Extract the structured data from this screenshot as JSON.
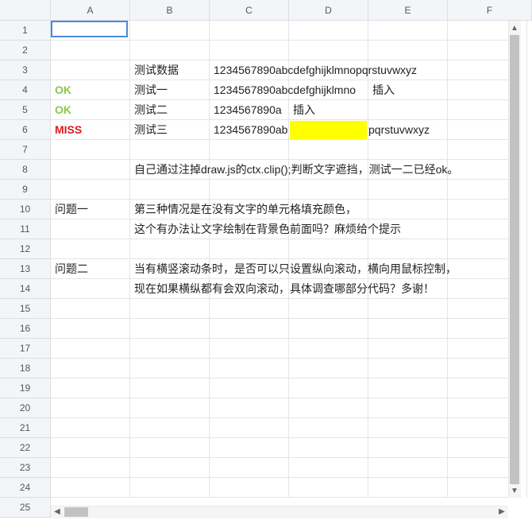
{
  "columns": [
    "A",
    "B",
    "C",
    "D",
    "E",
    "F"
  ],
  "rows": [
    "1",
    "2",
    "3",
    "4",
    "5",
    "6",
    "7",
    "8",
    "9",
    "10",
    "11",
    "12",
    "13",
    "14",
    "15",
    "16",
    "17",
    "18",
    "19",
    "20",
    "21",
    "22",
    "23",
    "24",
    "25"
  ],
  "cells": {
    "b3": "测试数据",
    "c3": "1234567890abcdefghijklmnopqrstuvwxyz",
    "a4": "OK",
    "b4": "测试一",
    "c4": "1234567890abcdefghijklmno",
    "d4": "插入",
    "a5": "OK",
    "b5": "测试二",
    "c5": "1234567890a",
    "c5b": "插入",
    "a6": "MISS",
    "b6": "测试三",
    "c6": "1234567890ab",
    "e6": "pqrstuvwxyz",
    "b8": "自己通过注掉draw.js的ctx.clip();判断文字遮挡，测试一二已经ok。",
    "a10": "问题一",
    "b10": "第三种情况是在没有文字的单元格填充颜色，",
    "b11": " 这个有办法让文字绘制在背景色前面吗？麻烦给个提示",
    "a13": "问题二",
    "b13": "当有横竖滚动条时，是否可以只设置纵向滚动，横向用鼠标控制，",
    "b14": "现在如果横纵都有会双向滚动，具体调查哪部分代码？多谢！"
  },
  "colors": {
    "ok": "#8ac84a",
    "miss": "#e0191b",
    "fill": "#ffff00",
    "selection": "#4b89dc"
  }
}
